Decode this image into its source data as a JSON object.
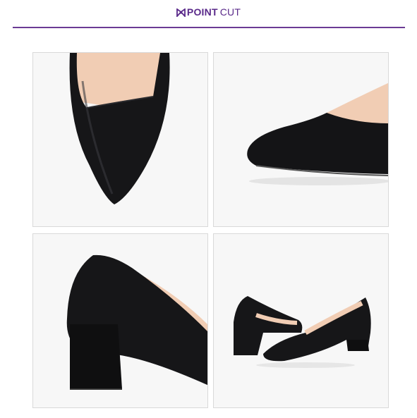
{
  "header": {
    "brand_word_1": "POINT",
    "brand_word_2": "CUT",
    "logo_icon": "bow-icon",
    "accent_color": "#5a2a8a"
  },
  "photos": [
    {
      "view": "toe-top",
      "icon": "shoe-toe-top-photo"
    },
    {
      "view": "toe-side",
      "icon": "shoe-toe-side-photo"
    },
    {
      "view": "heel",
      "icon": "shoe-heel-photo"
    },
    {
      "view": "pair",
      "icon": "shoe-pair-photo"
    }
  ]
}
